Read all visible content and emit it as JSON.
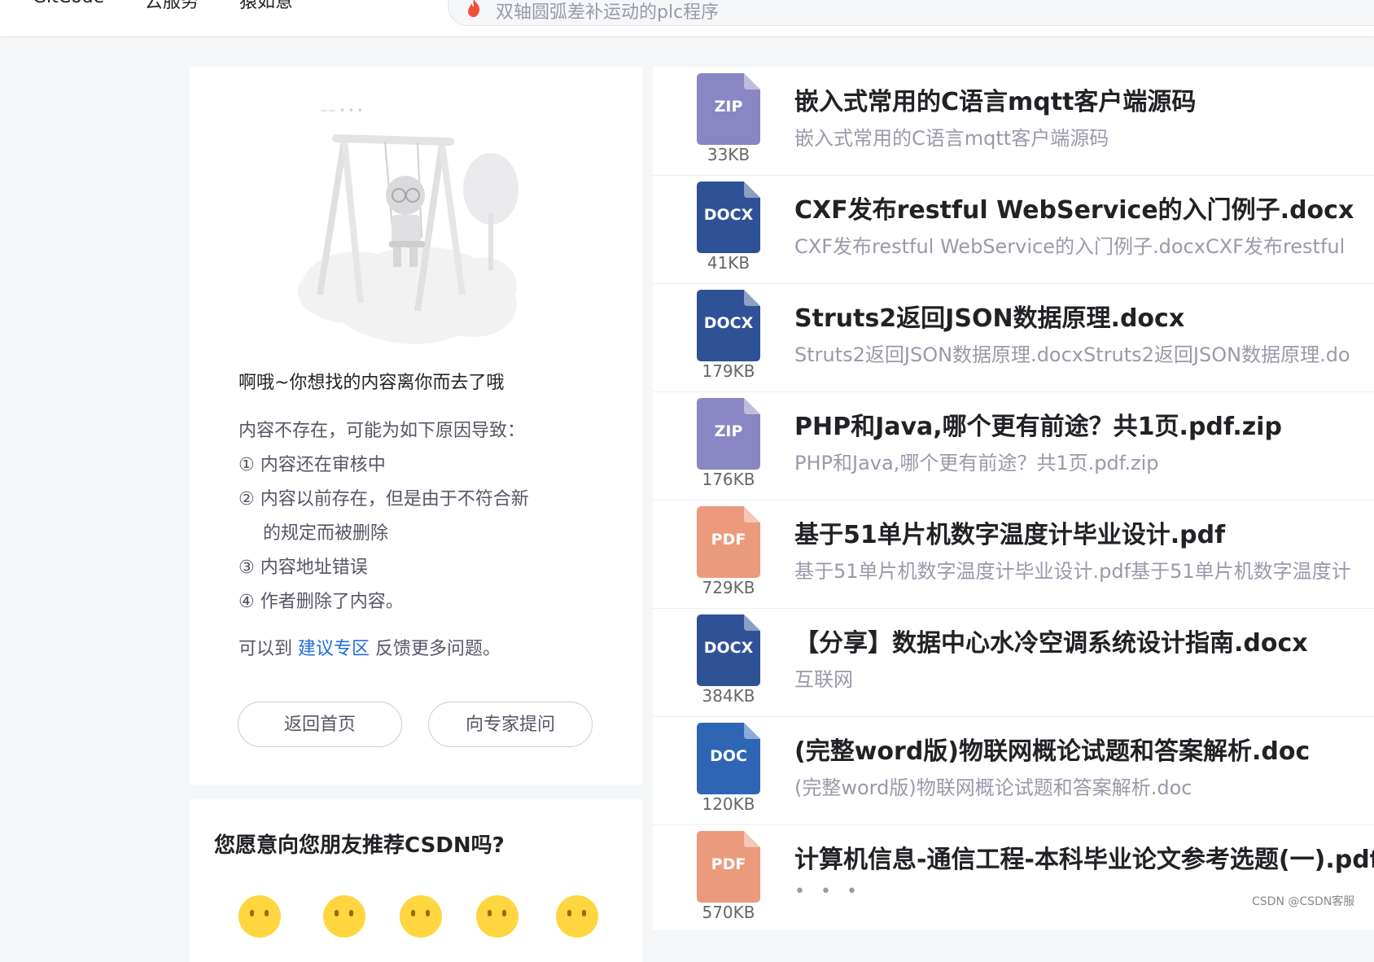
{
  "nav": {
    "items": [
      "GitCode",
      "云服务",
      "猿如意"
    ],
    "search_text": "双轴圆弧差补运动的plc程序"
  },
  "not_found": {
    "title": "啊哦~你想找的内容离你而去了哦",
    "reason_head": "内容不存在，可能为如下原因导致：",
    "reasons": [
      "① 内容还在审核中",
      "② 内容以前存在，但是由于不符合新",
      "的规定而被删除",
      "③ 内容地址错误",
      "④ 作者删除了内容。"
    ],
    "tail_prefix": "可以到",
    "tail_link": "建议专区",
    "tail_suffix": "反馈更多问题。",
    "home_button": "返回首页",
    "ask_button": "向专家提问"
  },
  "recommend": {
    "title": "您愿意向您朋友推荐CSDN吗?"
  },
  "files": [
    {
      "ext": "ZIP",
      "size": "33KB",
      "color": "#8a86c3",
      "title": "嵌入式常用的C语言mqtt客户端源码",
      "desc": "嵌入式常用的C语言mqtt客户端源码"
    },
    {
      "ext": "DOCX",
      "size": "41KB",
      "color": "#2f5196",
      "title": "CXF发布restful WebService的入门例子.docx",
      "desc": "CXF发布restful WebService的入门例子.docxCXF发布restful"
    },
    {
      "ext": "DOCX",
      "size": "179KB",
      "color": "#2f5196",
      "title": "Struts2返回JSON数据原理.docx",
      "desc": "Struts2返回JSON数据原理.docxStruts2返回JSON数据原理.do"
    },
    {
      "ext": "ZIP",
      "size": "176KB",
      "color": "#8a86c3",
      "title": "PHP和Java,哪个更有前途？共1页.pdf.zip",
      "desc": "PHP和Java,哪个更有前途？共1页.pdf.zip"
    },
    {
      "ext": "PDF",
      "size": "729KB",
      "color": "#ec9a7e",
      "title": "基于51单片机数字温度计毕业设计.pdf",
      "desc": "基于51单片机数字温度计毕业设计.pdf基于51单片机数字温度计"
    },
    {
      "ext": "DOCX",
      "size": "384KB",
      "color": "#2f5196",
      "title": "【分享】数据中心水冷空调系统设计指南.docx",
      "desc": "互联网"
    },
    {
      "ext": "DOC",
      "size": "120KB",
      "color": "#2e66b5",
      "title": "(完整word版)物联网概论试题和答案解析.doc",
      "desc": "(完整word版)物联网概论试题和答案解析.doc"
    },
    {
      "ext": "PDF",
      "size": "570KB",
      "color": "#ec9a7e",
      "title": "计算机信息-通信工程-本科毕业论文参考选题(一).pdf",
      "desc": "• • •"
    }
  ],
  "watermark": "CSDN @CSDN客服"
}
